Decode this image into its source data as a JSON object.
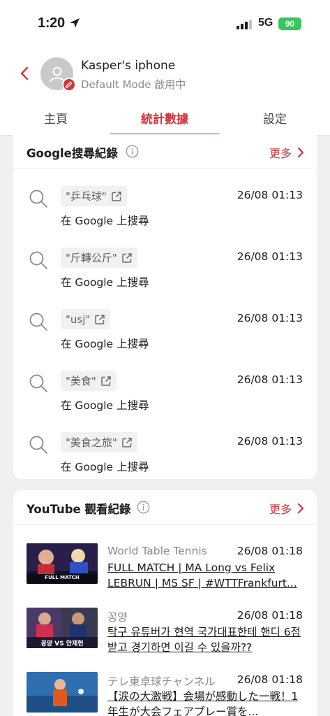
{
  "status_bar": {
    "time": "1:20",
    "network": "5G",
    "battery": "90"
  },
  "header": {
    "device_name": "Kasper's iphone",
    "mode": "Default Mode 啟用中",
    "tabs": [
      "主頁",
      "統計數據",
      "設定"
    ],
    "active_tab": "統計數據"
  },
  "google_card": {
    "title": "Google搜尋紀錄",
    "more": "更多",
    "rows": [
      {
        "query": "\"乒乓球\"",
        "time": "26/08 01:13",
        "subtitle": "在 Google 上搜尋"
      },
      {
        "query": "\"斤轉公斤\"",
        "time": "26/08 01:13",
        "subtitle": "在 Google 上搜尋"
      },
      {
        "query": "\"usj\"",
        "time": "26/08 01:13",
        "subtitle": "在 Google 上搜尋"
      },
      {
        "query": "\"美食\"",
        "time": "26/08 01:13",
        "subtitle": "在 Google 上搜尋"
      },
      {
        "query": "\"美食之旅\"",
        "time": "26/08 01:13",
        "subtitle": "在 Google 上搜尋"
      }
    ]
  },
  "youtube_card": {
    "title": "YouTube 觀看紀錄",
    "more": "更多",
    "rows": [
      {
        "channel": "World Table Tennis",
        "time": "26/08 01:18",
        "title": "FULL MATCH | MA Long vs Felix LEBRUN | MS SF | #WTTFrankfurt...",
        "thumb_label": "FULL MATCH"
      },
      {
        "channel": "꽁양",
        "time": "26/08 01:18",
        "title": "탁구 유튜버가 현역 국가대표한테 핸디 6점 받고 경기하면 이길 수 있을까??",
        "thumb_label": "꽁양 VS 안재현"
      },
      {
        "channel": "テレ東卓球チャンネル",
        "time": "26/08 01:18",
        "title": "【涙の大激戦】会場が感動した一戦！1年生が大会フェアプレー賞を...",
        "thumb_label": ""
      }
    ]
  },
  "colors": {
    "accent": "#d9313a",
    "battery": "#35c759"
  }
}
